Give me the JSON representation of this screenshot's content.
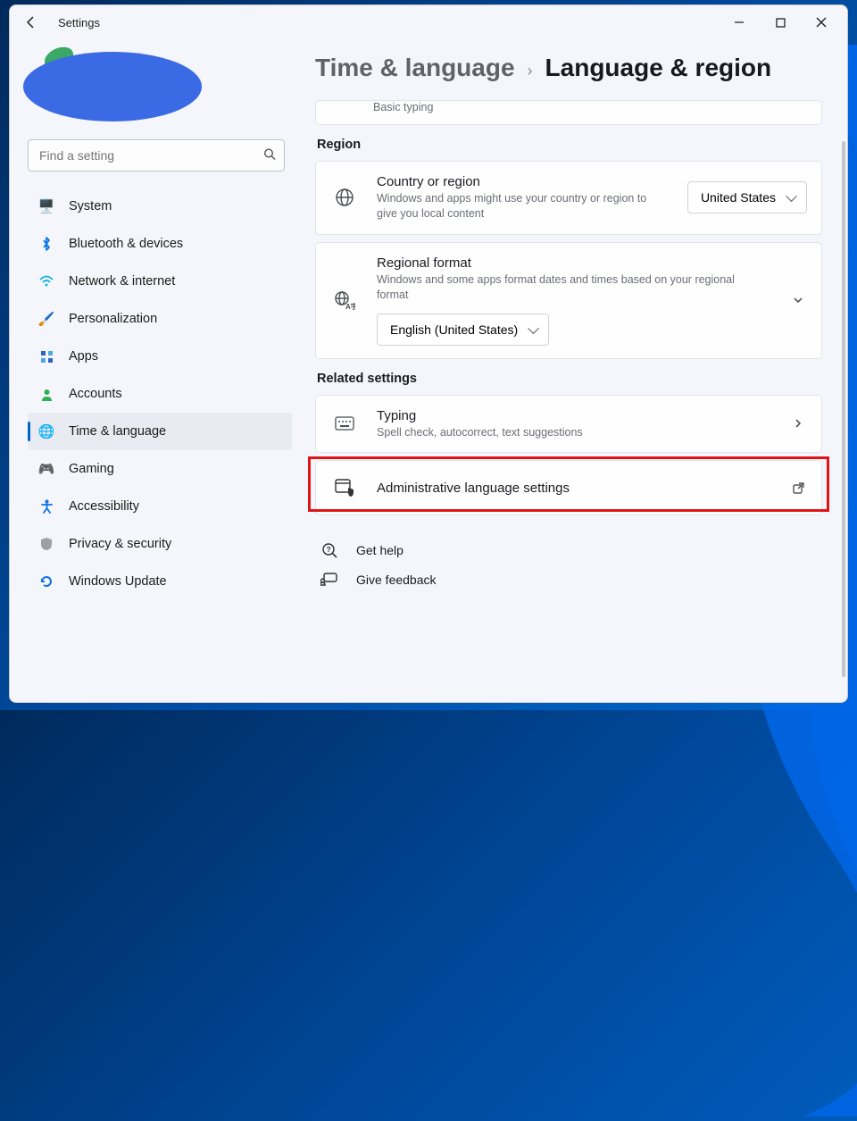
{
  "window": {
    "title": "Settings"
  },
  "search": {
    "placeholder": "Find a setting"
  },
  "sidebar": {
    "items": [
      {
        "label": "System"
      },
      {
        "label": "Bluetooth & devices"
      },
      {
        "label": "Network & internet"
      },
      {
        "label": "Personalization"
      },
      {
        "label": "Apps"
      },
      {
        "label": "Accounts"
      },
      {
        "label": "Time & language"
      },
      {
        "label": "Gaming"
      },
      {
        "label": "Accessibility"
      },
      {
        "label": "Privacy & security"
      },
      {
        "label": "Windows Update"
      }
    ]
  },
  "breadcrumb": {
    "parent": "Time & language",
    "current": "Language & region"
  },
  "truncated": {
    "text": "Basic typing"
  },
  "section_region": {
    "heading": "Region"
  },
  "country_card": {
    "title": "Country or region",
    "sub": "Windows and apps might use your country or region to give you local content",
    "value": "United States"
  },
  "regional_format_card": {
    "title": "Regional format",
    "sub": "Windows and some apps format dates and times based on your regional format",
    "value": "English (United States)"
  },
  "section_related": {
    "heading": "Related settings"
  },
  "typing_card": {
    "title": "Typing",
    "sub": "Spell check, autocorrect, text suggestions"
  },
  "admin_card": {
    "title": "Administrative language settings"
  },
  "help": {
    "get_help": "Get help",
    "feedback": "Give feedback"
  }
}
